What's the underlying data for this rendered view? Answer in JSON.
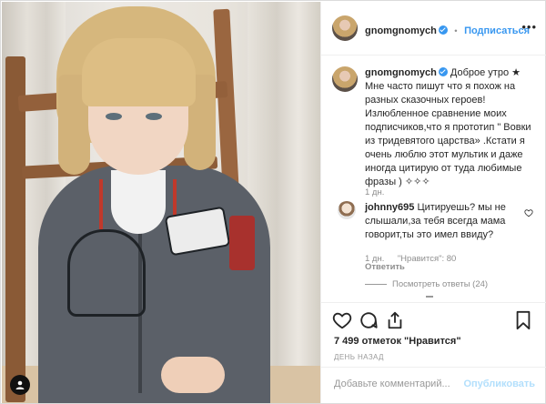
{
  "post": {
    "username": "gnomgnomych",
    "follow_label": "Подписаться",
    "separator": "•",
    "more": "•••"
  },
  "caption": {
    "username": "gnomgnomych",
    "text": " Доброе утро ★\nМне часто пишут что я похож на разных сказочных героев! Излюбленное сравнение моих подписчиков,что я прототип \" Вовки из тридевятого царства» .Кстати я очень люблю этот мультик и даже иногда цитирую от туда любимые фразы ) ✧✧✧",
    "time": "1 дн."
  },
  "comment": {
    "username": "johnny695",
    "text": " Цитируешь? мы не слышали,за тебя всегда мама говорит,ты это имел ввиду?",
    "time": "1 дн.",
    "likes": "\"Нравится\": 80",
    "reply": "Ответить",
    "view_replies": "Посмотреть ответы (24)"
  },
  "stats": {
    "likes": "7 499 отметок \"Нравится\"",
    "date": "ДЕНЬ НАЗАД"
  },
  "composer": {
    "placeholder": "Добавьте комментарий...",
    "publish": "Опубликовать"
  },
  "icons": [
    "heart-icon",
    "comment-icon",
    "share-icon",
    "bookmark-icon",
    "user-icon",
    "more-icon"
  ]
}
